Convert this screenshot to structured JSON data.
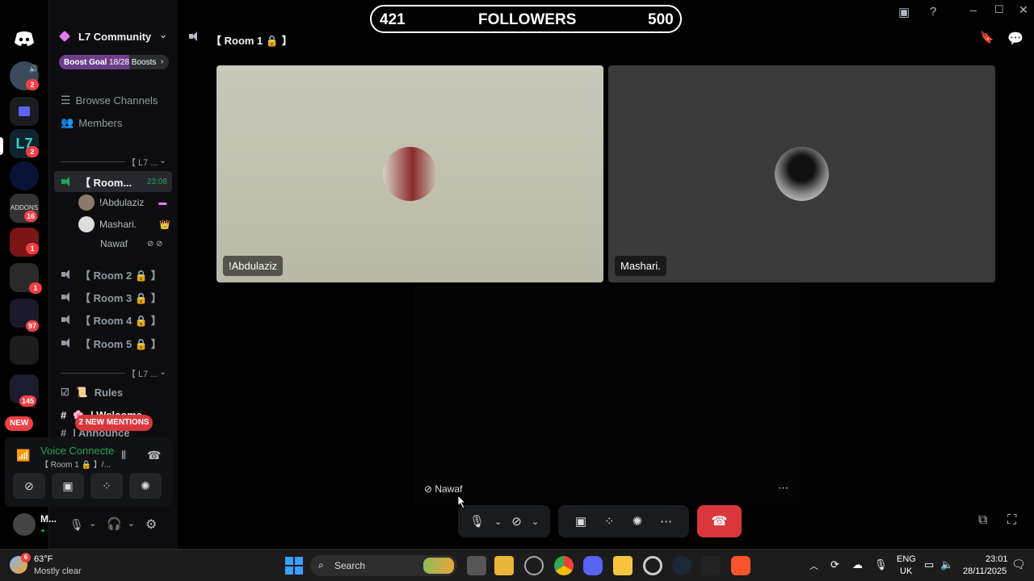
{
  "overlay": {
    "followers_current": "421",
    "followers_label": "FOLLOWERS",
    "followers_goal": "500"
  },
  "rail": {
    "badges": [
      "2",
      "2",
      "16",
      "1",
      "1",
      "97",
      "145"
    ],
    "new_label": "NEW"
  },
  "sidebar": {
    "server_name": "L7 Community",
    "boost_label": "Boost Goal",
    "boost_progress": "18/28 Boosts",
    "boost_fraction": 0.64,
    "browse_channels": "Browse Channels",
    "members": "Members",
    "category1": "【 L7 ...",
    "active_room": "【 Room...",
    "active_room_time": "23:08",
    "users": [
      "!Abdulaziz",
      "Mashari.",
      "Nawaf"
    ],
    "rooms": [
      "【 Room 2 🔒 】",
      "【 Room 3 🔒 】",
      "【 Room 4 🔒 】",
      "【 Room 5 🔒 】"
    ],
    "category2": "【 L7 ...",
    "rules": "Rules",
    "welcome": "| Welcome",
    "announce": "| Announce",
    "mentions": "2 NEW MENTIONS"
  },
  "voice_panel": {
    "status": "Voice Connected",
    "room": "【 Room 1 🔒 】/..."
  },
  "user_panel": {
    "name": "M..."
  },
  "main": {
    "room_title": "【 Room 1 🔒 】",
    "tiles": [
      {
        "name": "!Abdulaziz"
      },
      {
        "name": "Mashari."
      }
    ],
    "third_tile": "Nawaf"
  },
  "taskbar": {
    "weather_temp": "63°F",
    "weather_desc": "Mostly clear",
    "weather_badge": "6",
    "search_label": "Search",
    "lang": "ENG",
    "region": "UK",
    "time": "23:01",
    "date": "28/11/2025"
  },
  "colors": {
    "green": "#23a55a",
    "red": "#da373c",
    "accent": "#5865f2"
  }
}
